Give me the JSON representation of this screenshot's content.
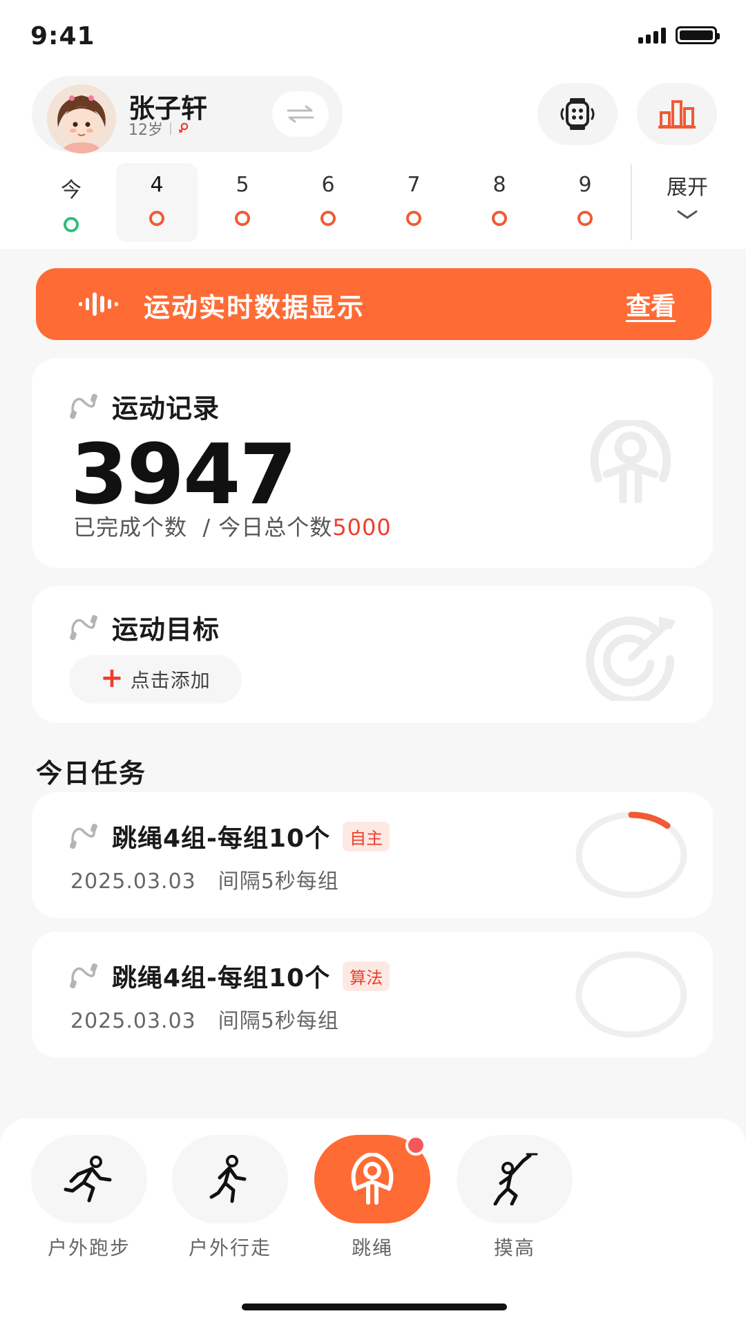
{
  "status_bar": {
    "time": "9:41"
  },
  "profile": {
    "name": "张子轩",
    "age": "12岁"
  },
  "date_strip": {
    "items": [
      {
        "label": "今",
        "status": "green"
      },
      {
        "label": "4",
        "status": "red",
        "selected": true
      },
      {
        "label": "5",
        "status": "red"
      },
      {
        "label": "6",
        "status": "red"
      },
      {
        "label": "7",
        "status": "red"
      },
      {
        "label": "8",
        "status": "red"
      },
      {
        "label": "9",
        "status": "red"
      }
    ],
    "expand_label": "展开"
  },
  "banner": {
    "text": "运动实时数据显示",
    "link": "查看"
  },
  "record_card": {
    "title": "运动记录",
    "count": "3947",
    "subtitle": "已完成个数  / 今日总个数",
    "total": "5000"
  },
  "goal_card": {
    "title": "运动目标",
    "add_label": "点击添加"
  },
  "tasks_section": {
    "title": "今日任务",
    "tasks": [
      {
        "title": "跳绳4组-每组10个",
        "tag": "自主",
        "date": "2025.03.03",
        "note": "间隔5秒每组",
        "progress": 0.12
      },
      {
        "title": "跳绳4组-每组10个",
        "tag": "算法",
        "date": "2025.03.03",
        "note": "间隔5秒每组",
        "progress": 0
      }
    ]
  },
  "bottom_nav": {
    "items": [
      {
        "label": "户外跑步",
        "icon": "running-icon"
      },
      {
        "label": "户外行走",
        "icon": "walking-icon"
      },
      {
        "label": "跳绳",
        "icon": "jump-rope-icon",
        "active": true
      },
      {
        "label": "摸高",
        "icon": "touch-high-icon"
      }
    ]
  },
  "colors": {
    "accent": "#ff6b35",
    "status_red": "#f05a35",
    "status_green": "#2fbf7a",
    "highlight_red": "#f03c2a"
  }
}
